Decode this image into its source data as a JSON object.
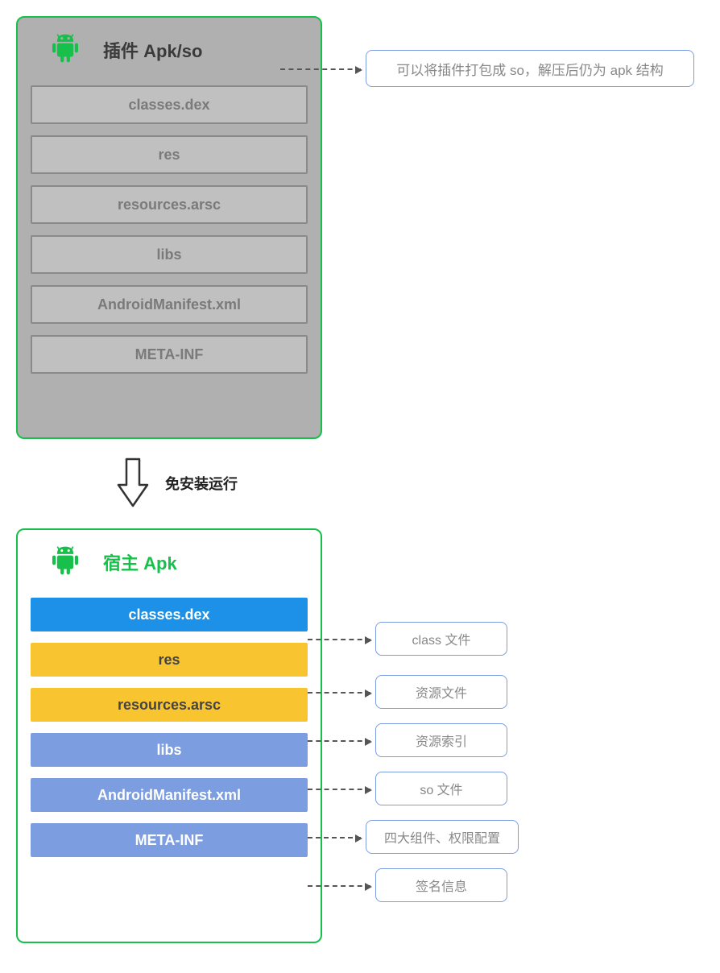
{
  "plugin_panel": {
    "title": "插件 Apk/so",
    "items": [
      "classes.dex",
      "res",
      "resources.arsc",
      "libs",
      "AndroidManifest.xml",
      "META-INF"
    ],
    "note": "可以将插件打包成 so，解压后仍为 apk 结构"
  },
  "transition_label": "免安装运行",
  "host_panel": {
    "title": "宿主 Apk",
    "items": [
      {
        "label": "classes.dex",
        "color": "blue",
        "note": "class 文件"
      },
      {
        "label": "res",
        "color": "yellow",
        "note": "资源文件"
      },
      {
        "label": "resources.arsc",
        "color": "yellow",
        "note": "资源索引"
      },
      {
        "label": "libs",
        "color": "slate",
        "note": "so 文件"
      },
      {
        "label": "AndroidManifest.xml",
        "color": "slate",
        "note": "四大组件、权限配置"
      },
      {
        "label": "META-INF",
        "color": "slate",
        "note": "签名信息"
      }
    ]
  },
  "colors": {
    "green": "#16c04a",
    "blue": "#1d90e8",
    "yellow": "#f8c530",
    "slate": "#7c9de0"
  }
}
